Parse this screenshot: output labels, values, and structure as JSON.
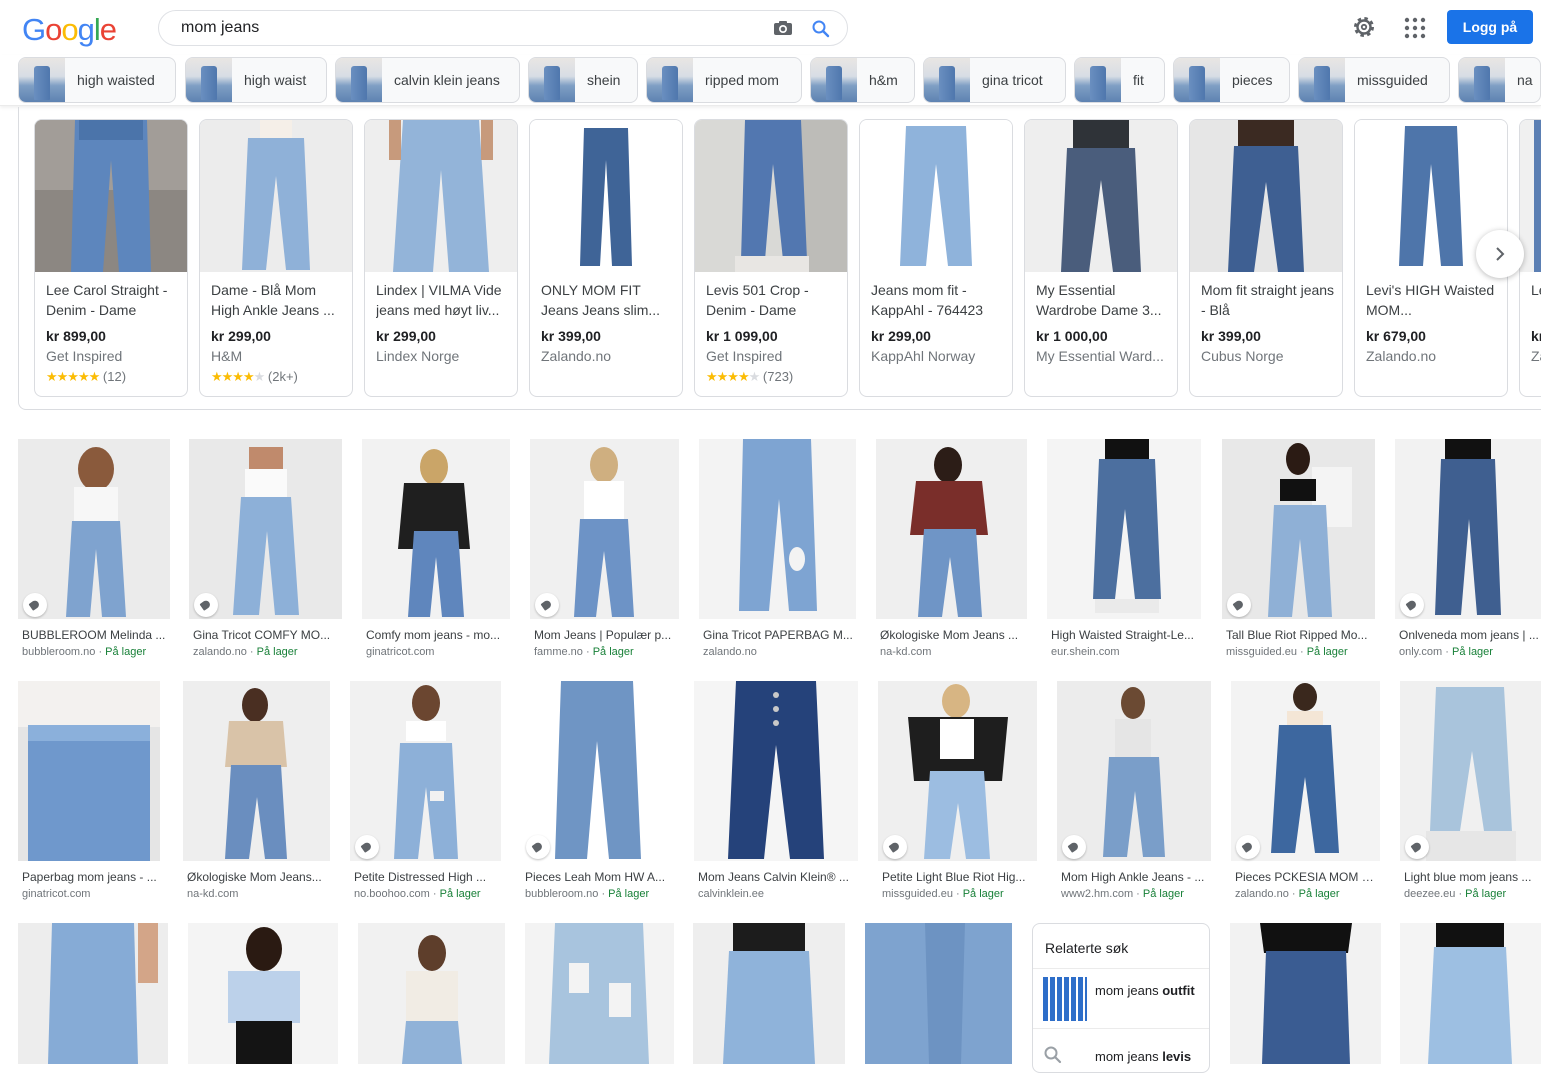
{
  "header": {
    "query": "mom jeans",
    "login_label": "Logg på"
  },
  "chips": [
    {
      "label": "high waisted"
    },
    {
      "label": "high waist"
    },
    {
      "label": "calvin klein jeans"
    },
    {
      "label": "shein"
    },
    {
      "label": "ripped mom"
    },
    {
      "label": "h&m"
    },
    {
      "label": "gina tricot"
    },
    {
      "label": "fit"
    },
    {
      "label": "pieces"
    },
    {
      "label": "missguided"
    },
    {
      "label": "na"
    }
  ],
  "products": [
    {
      "title": "Lee Carol Straight - Denim - Dame",
      "price": "kr 899,00",
      "store": "Get Inspired",
      "rating": "(12)",
      "stars": 5
    },
    {
      "title": "Dame - Blå Mom High Ankle Jeans ...",
      "price": "kr 299,00",
      "store": "H&M",
      "rating": "(2k+)",
      "stars": 4
    },
    {
      "title": "Lindex | VILMA Vide jeans med høyt liv...",
      "price": "kr 299,00",
      "store": "Lindex Norge",
      "rating": "",
      "stars": 0
    },
    {
      "title": "ONLY MOM FIT Jeans Jeans slim...",
      "price": "kr 399,00",
      "store": "Zalando.no",
      "rating": "",
      "stars": 0
    },
    {
      "title": "Levis 501 Crop - Denim - Dame",
      "price": "kr 1 099,00",
      "store": "Get Inspired",
      "rating": "(723)",
      "stars": 4
    },
    {
      "title": "Jeans mom fit - KappAhl - 764423",
      "price": "kr 299,00",
      "store": "KappAhl Norway",
      "rating": "",
      "stars": 0
    },
    {
      "title": "My Essential Wardrobe Dame 3...",
      "price": "kr 1 000,00",
      "store": "My Essential Ward...",
      "rating": "",
      "stars": 0
    },
    {
      "title": "Mom fit straight jeans - Blå",
      "price": "kr 399,00",
      "store": "Cubus Norge",
      "rating": "",
      "stars": 0
    },
    {
      "title": "Levi's HIGH Waisted MOM...",
      "price": "kr 679,00",
      "store": "Zalando.no",
      "rating": "",
      "stars": 0
    },
    {
      "title": "Le W",
      "price": "kr",
      "store": "Za",
      "rating": "",
      "stars": 0
    }
  ],
  "row1": [
    {
      "title": "BUBBLEROOM Melinda ...",
      "source": "bubbleroom.no",
      "stock": "På lager"
    },
    {
      "title": "Gina Tricot COMFY MO...",
      "source": "zalando.no",
      "stock": "På lager"
    },
    {
      "title": "Comfy mom jeans - mo...",
      "source": "ginatricot.com",
      "stock": ""
    },
    {
      "title": "Mom Jeans | Populær p...",
      "source": "famme.no",
      "stock": "På lager"
    },
    {
      "title": "Gina Tricot PAPERBAG M...",
      "source": "zalando.no",
      "stock": ""
    },
    {
      "title": "Økologiske Mom Jeans ...",
      "source": "na-kd.com",
      "stock": ""
    },
    {
      "title": "High Waisted Straight-Le...",
      "source": "eur.shein.com",
      "stock": ""
    },
    {
      "title": "Tall Blue Riot Ripped Mo...",
      "source": "missguided.eu",
      "stock": "På lager"
    },
    {
      "title": "Onlveneda mom jeans | ...",
      "source": "only.com",
      "stock": "På lager"
    }
  ],
  "row2": [
    {
      "title": "Paperbag mom jeans - ...",
      "source": "ginatricot.com",
      "stock": ""
    },
    {
      "title": "Økologiske Mom Jeans...",
      "source": "na-kd.com",
      "stock": ""
    },
    {
      "title": "Petite Distressed High ...",
      "source": "no.boohoo.com",
      "stock": "På lager"
    },
    {
      "title": "Pieces Leah Mom HW A...",
      "source": "bubbleroom.no",
      "stock": "På lager"
    },
    {
      "title": "Mom Jeans Calvin Klein® ...",
      "source": "calvinklein.ee",
      "stock": ""
    },
    {
      "title": "Petite Light Blue Riot Hig...",
      "source": "missguided.eu",
      "stock": "På lager"
    },
    {
      "title": "Mom High Ankle Jeans - ...",
      "source": "www2.hm.com",
      "stock": "På lager"
    },
    {
      "title": "Pieces PCKESIA MOM - ...",
      "source": "zalando.no",
      "stock": "På lager"
    },
    {
      "title": "Light blue mom jeans ...",
      "source": "deezee.eu",
      "stock": "På lager"
    }
  ],
  "related": {
    "title": "Relaterte søk",
    "item1_prefix": "mom jeans ",
    "item1_bold": "out­fit",
    "item2_prefix": "mom jeans ",
    "item2_bold": "levis"
  },
  "colors": {
    "accent": "#1a73e8",
    "star": "#fbbc04",
    "border": "#dadce0"
  }
}
